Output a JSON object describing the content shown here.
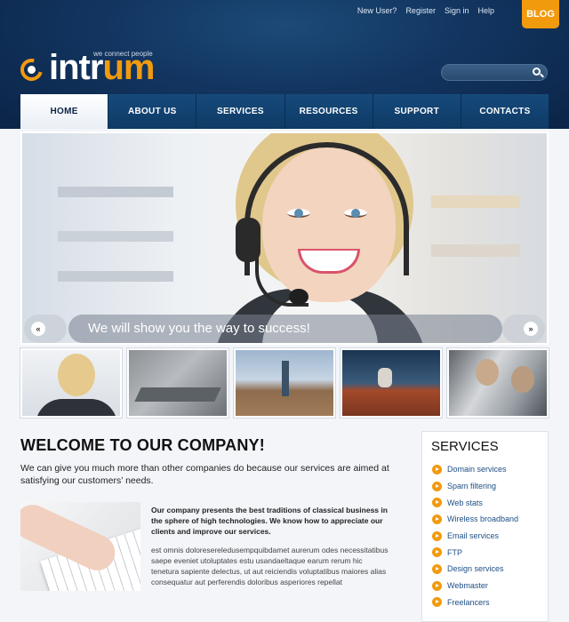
{
  "header": {
    "top_links": [
      "New User?",
      "Register",
      "Sign in",
      "Help"
    ],
    "blog_label": "BLOG",
    "logo_white": "intr",
    "logo_orange": "um",
    "tagline": "we connect people",
    "search_placeholder": ""
  },
  "nav": {
    "items": [
      "HOME",
      "ABOUT US",
      "SERVICES",
      "RESOURCES",
      "SUPPORT",
      "CONTACTS"
    ],
    "active": "HOME"
  },
  "slider": {
    "caption": "We will show you the way to success!",
    "prev_symbol": "«",
    "next_symbol": "»"
  },
  "welcome": {
    "title": "WELCOME TO OUR COMPANY!",
    "text": "We can give you much more than other companies do because our services are aimed at satisfying our customers’ needs.",
    "bold_text": "Our company presents the best traditions of classical business in the sphere of high technologies. We know how to appreciate our clients and improve our services.",
    "small_text": "est omnis doloresereledusempquibdamet aurerum odes necessitatibus saepe eveniet utoluptates estu usandaeltaque earum rerum hic tenetura sapiente delectus, ut aut reiciendis voluptatibus maiores alias consequatur aut perferendis doloribus asperiores repellat"
  },
  "services": {
    "title": "SERVICES",
    "items": [
      "Domain services",
      "Spam filtering",
      "Web stats",
      "Wireless broadband",
      "Email services",
      "FTP",
      "Design services",
      "Webmaster",
      "Freelancers"
    ]
  },
  "colors": {
    "accent": "#f29a0e",
    "header_dark": "#0b2447",
    "link": "#1d4f86"
  }
}
